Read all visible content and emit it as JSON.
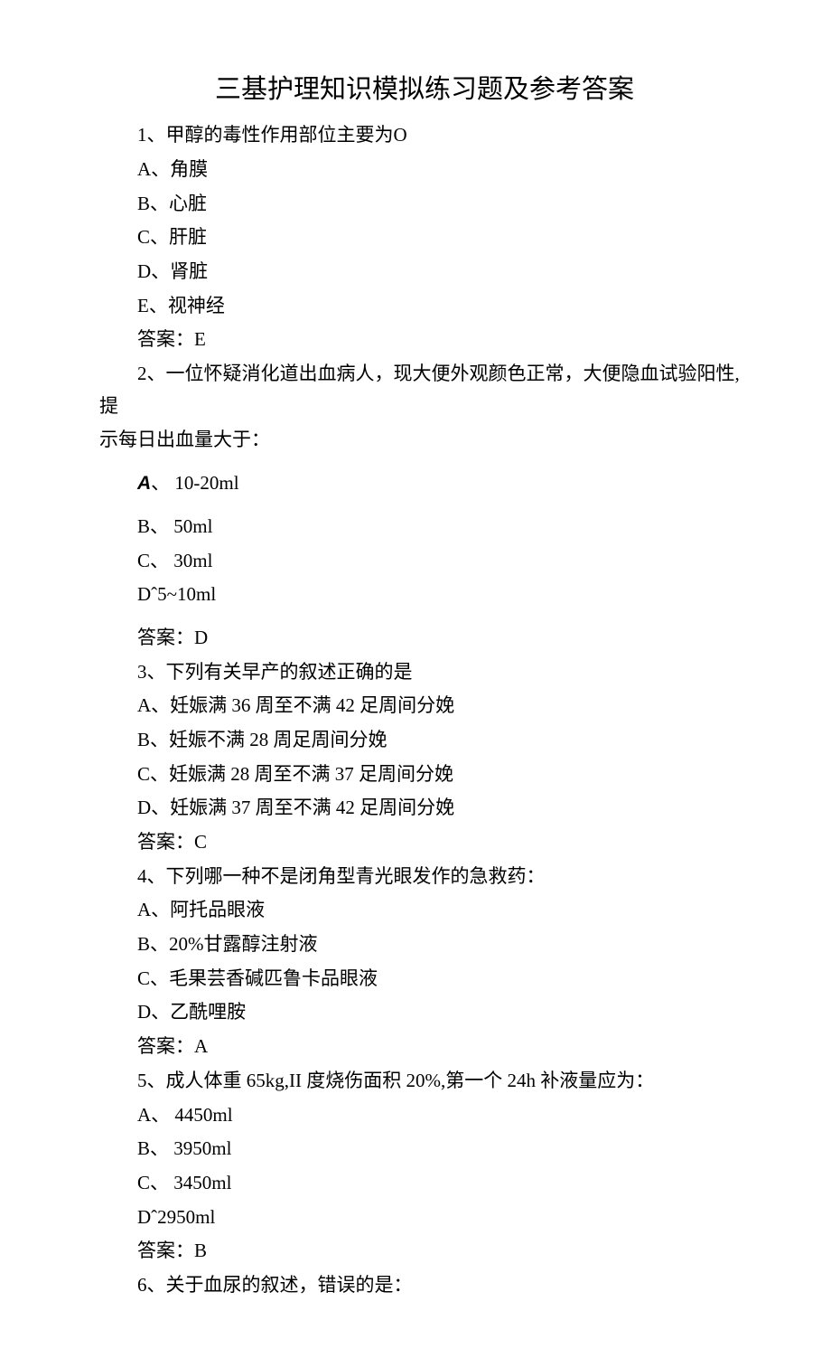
{
  "title": "三基护理知识模拟练习题及参考答案",
  "q1": {
    "stem": "1、甲醇的毒性作用部位主要为O",
    "a": "A、角膜",
    "b": "B、心脏",
    "c": "C、肝脏",
    "d": "D、肾脏",
    "e": "E、视神经",
    "answer": "答案：E"
  },
  "q2": {
    "stem1": "2、一位怀疑消化道出血病人，现大便外观颜色正常，大便隐血试验阳性,提",
    "stem2": "示每日出血量大于：",
    "a_prefix": "A",
    "a_suffix": "、 10-20ml",
    "b": "B、 50ml",
    "c": "C、 30ml",
    "d": "Dˆ5~10ml",
    "answer": "答案：D"
  },
  "q3": {
    "stem": "3、下列有关早产的叙述正确的是",
    "a": "A、妊娠满 36 周至不满 42 足周间分娩",
    "b": "B、妊娠不满 28 周足周间分娩",
    "c": "C、妊娠满 28 周至不满 37 足周间分娩",
    "d": "D、妊娠满 37 周至不满 42 足周间分娩",
    "answer": "答案：C"
  },
  "q4": {
    "stem": "4、下列哪一种不是闭角型青光眼发作的急救药：",
    "a": "A、阿托品眼液",
    "b": "B、20%甘露醇注射液",
    "c": "C、毛果芸香碱匹鲁卡品眼液",
    "d": "D、乙酰哩胺",
    "answer": "答案：A"
  },
  "q5": {
    "stem": "5、成人体重 65kg,II 度烧伤面积 20%,第一个 24h 补液量应为：",
    "a": "A、 4450ml",
    "b": "B、 3950ml",
    "c": "C、 3450ml",
    "d": "Dˆ2950ml",
    "answer": "答案：B"
  },
  "q6": {
    "stem": "6、关于血尿的叙述，错误的是："
  }
}
